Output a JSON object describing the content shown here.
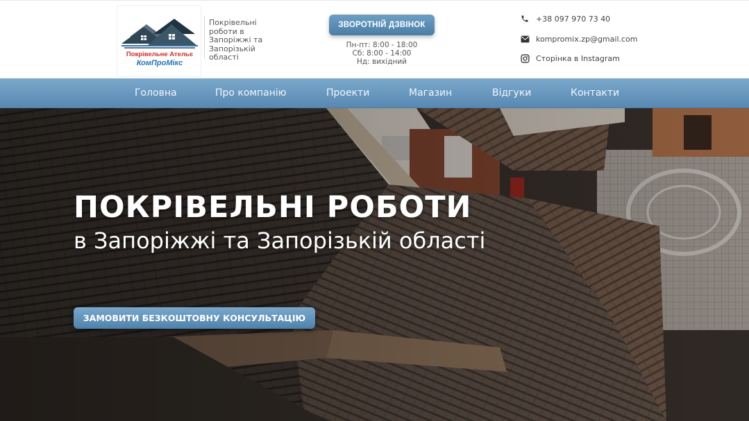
{
  "header": {
    "logo": {
      "line1": "Покрівельне Ательє",
      "line2": "КомПроМікс"
    },
    "tagline": "Покрівельні роботи в Запоріжжі та Запорізькій області",
    "callback_label": "ЗВОРОТНІЙ ДЗВІНОК",
    "hours": [
      "Пн-пт: 8:00 - 18:00",
      "Сб: 8:00 - 14:00",
      "Нд: вихідний"
    ],
    "contacts": {
      "phone": "+38 097 970 73 40",
      "email": "kompromix.zp@gmail.com",
      "instagram": "Сторінка в Instagram"
    }
  },
  "nav": {
    "items": [
      {
        "label": "Головна"
      },
      {
        "label": "Про компанію"
      },
      {
        "label": "Проекти"
      },
      {
        "label": "Магазин"
      },
      {
        "label": "Відгуки"
      },
      {
        "label": "Контакти"
      }
    ]
  },
  "hero": {
    "title": "ПОКРІВЕЛЬНІ РОБОТИ",
    "subtitle": "в Запоріжжі та Запорізькій області",
    "cta_label": "ЗАМОВИТИ БЕЗКОШТОВНУ КОНСУЛЬТАЦІЮ"
  },
  "colors": {
    "nav_blue": "#6a98be",
    "button_blue": "#5a8db5",
    "logo_red": "#d0302a",
    "logo_blue": "#2a74b8"
  },
  "icons": {
    "phone": "phone-icon",
    "email": "mail-icon",
    "instagram": "instagram-icon"
  }
}
